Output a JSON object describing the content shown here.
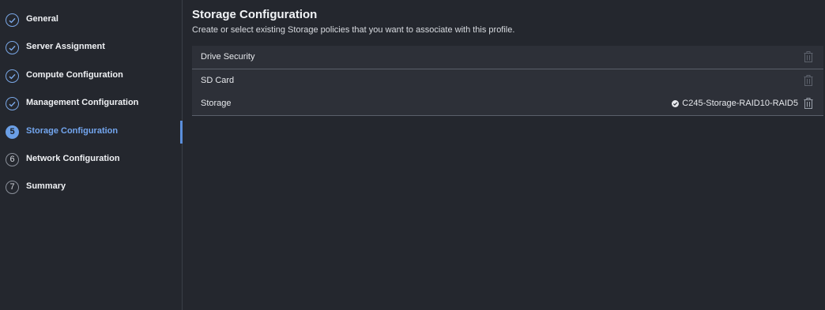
{
  "steps": [
    {
      "label": "General",
      "state": "done",
      "icon": "check-circle-icon"
    },
    {
      "label": "Server Assignment",
      "state": "done",
      "icon": "check-circle-icon"
    },
    {
      "label": "Compute Configuration",
      "state": "done",
      "icon": "check-circle-icon"
    },
    {
      "label": "Management Configuration",
      "state": "done",
      "icon": "check-circle-icon"
    },
    {
      "label": "Storage Configuration",
      "state": "active",
      "number": "5"
    },
    {
      "label": "Network Configuration",
      "state": "pending",
      "number": "6"
    },
    {
      "label": "Summary",
      "state": "pending",
      "number": "7"
    }
  ],
  "main": {
    "title": "Storage Configuration",
    "subtitle": "Create or select existing Storage policies that you want to associate with this profile.",
    "policies": [
      {
        "label": "Drive Security",
        "value": "",
        "icon": "trash-icon"
      },
      {
        "label": "SD Card",
        "value": "",
        "icon": "trash-icon"
      },
      {
        "label": "Storage",
        "value": "C245-Storage-RAID10-RAID5",
        "status_icon": "check-circle-filled-icon",
        "icon": "trash-icon"
      }
    ]
  },
  "colors": {
    "background": "#24272e",
    "accent": "#6b9fe6",
    "row_background": "#2d3038"
  }
}
